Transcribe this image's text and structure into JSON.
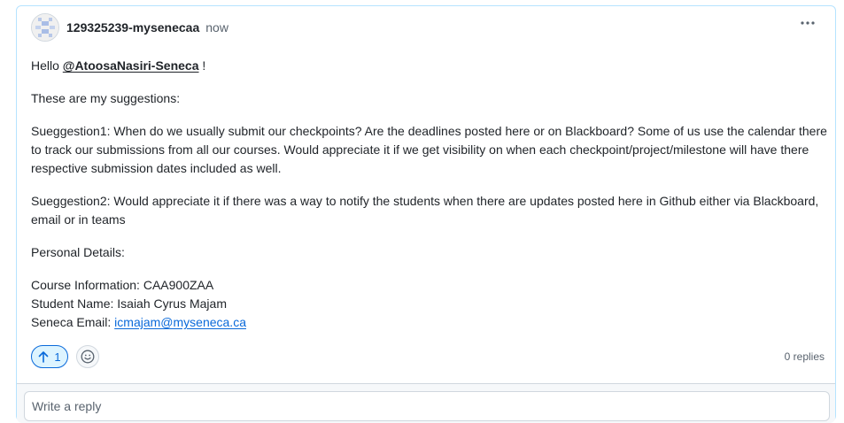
{
  "comment": {
    "author": "129325239-mysenecaa",
    "time": "now",
    "greeting_prefix": "Hello",
    "mention": "@AtoosaNasiri-Seneca",
    "greeting_suffix": "!",
    "intro": "These are my suggestions:",
    "suggestion1": "Sueggestion1: When do we usually submit our checkpoints? Are the deadlines posted here or on Blackboard? Some of us use the calendar there to track our submissions from all our courses. Would appreciate it if we get visibility on when each checkpoint/project/milestone will have there respective submission dates included as well.",
    "suggestion2": "Sueggestion2: Would appreciate it if there was a way to notify the students when there are updates posted here in Github either via Blackboard, email or in teams",
    "personal_heading": "Personal Details:",
    "course_info": "Course Information: CAA900ZAA",
    "student_name": "Student Name: Isaiah Cyrus Majam",
    "email_label": "Seneca Email:",
    "email": "icmajam@myseneca.ca"
  },
  "footer": {
    "upvote_count": "1",
    "replies": "0 replies"
  },
  "reply": {
    "placeholder": "Write a reply"
  },
  "icons": {
    "avatar": "identicon-avatar",
    "kebab": "kebab-horizontal-icon",
    "upvote": "arrow-up-icon",
    "emoji": "smiley-icon"
  },
  "colors": {
    "accent": "#0969da",
    "upvote_bg": "#ddf4ff",
    "card_border": "#b6e3ff",
    "muted": "#59636e"
  }
}
